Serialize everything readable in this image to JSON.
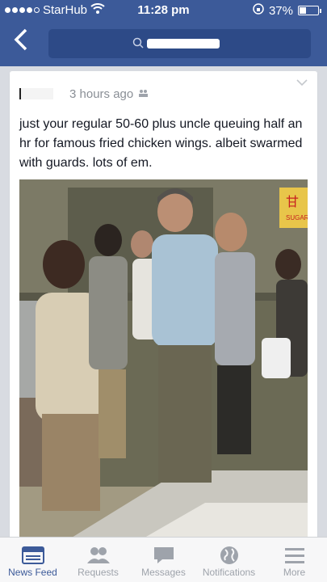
{
  "status": {
    "carrier": "StarHub",
    "time": "11:28 pm",
    "battery_text": "37%",
    "battery_level": 0.37
  },
  "nav": {
    "back_icon": "chevron-left-icon"
  },
  "post": {
    "timestamp": "3 hours ago",
    "text": "just your regular 50-60 plus uncle queuing half an hr for famous fried chicken wings. albeit swarmed with guards. lots of em.",
    "sign_text": "SUGAR",
    "sign_char": "甘"
  },
  "tabs": [
    {
      "label": "News Feed",
      "icon": "news-feed-icon",
      "active": true
    },
    {
      "label": "Requests",
      "icon": "friends-icon",
      "active": false
    },
    {
      "label": "Messages",
      "icon": "messages-icon",
      "active": false
    },
    {
      "label": "Notifications",
      "icon": "globe-icon",
      "active": false
    },
    {
      "label": "More",
      "icon": "menu-icon",
      "active": false
    }
  ],
  "colors": {
    "brand": "#3c5a99",
    "muted": "#9ea3ab"
  }
}
